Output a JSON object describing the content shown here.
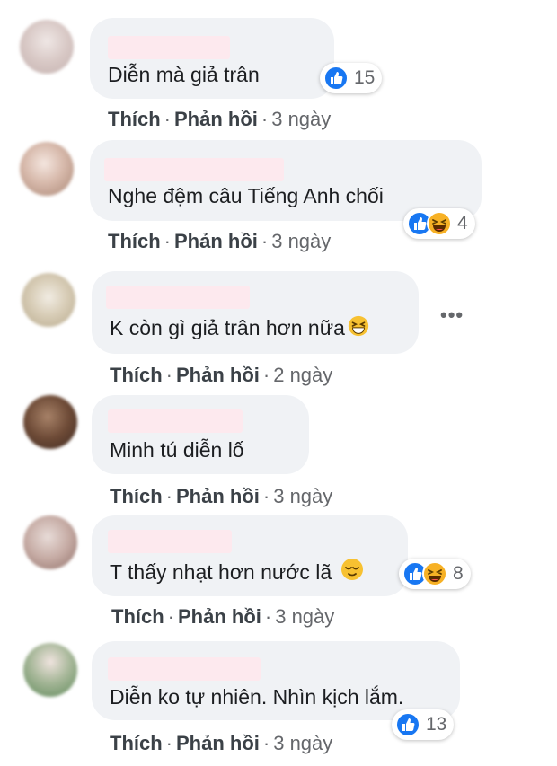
{
  "actions": {
    "like": "Thích",
    "reply": "Phản hồi",
    "sep": "·"
  },
  "comments": [
    {
      "text": "Diễn mà giả trân",
      "reactions": [
        "like-icon"
      ],
      "count": "15",
      "time": "3 ngày"
    },
    {
      "text": "Nghe đệm câu Tiếng Anh chối",
      "reactions": [
        "like-icon",
        "haha-icon"
      ],
      "count": "4",
      "time": "3 ngày"
    },
    {
      "text": "K còn gì giả trân hơn nữa",
      "reactions": [],
      "count": "",
      "time": "2 ngày",
      "more": "•••"
    },
    {
      "text": "Minh tú diễn lố",
      "reactions": [],
      "count": "",
      "time": "3 ngày"
    },
    {
      "text": "T thấy nhạt hơn nước lã",
      "reactions": [
        "like-icon",
        "haha-icon"
      ],
      "count": "8",
      "time": "3 ngày"
    },
    {
      "text": "Diễn ko tự nhiên. Nhìn kịch lắm.",
      "reactions": [
        "like-icon"
      ],
      "count": "13",
      "time": "3 ngày"
    }
  ],
  "colors": {
    "bubble": "#f0f2f5",
    "like_blue": "#1877f2",
    "haha_yellow": "#f7b125",
    "meta_gray": "#65676b"
  }
}
